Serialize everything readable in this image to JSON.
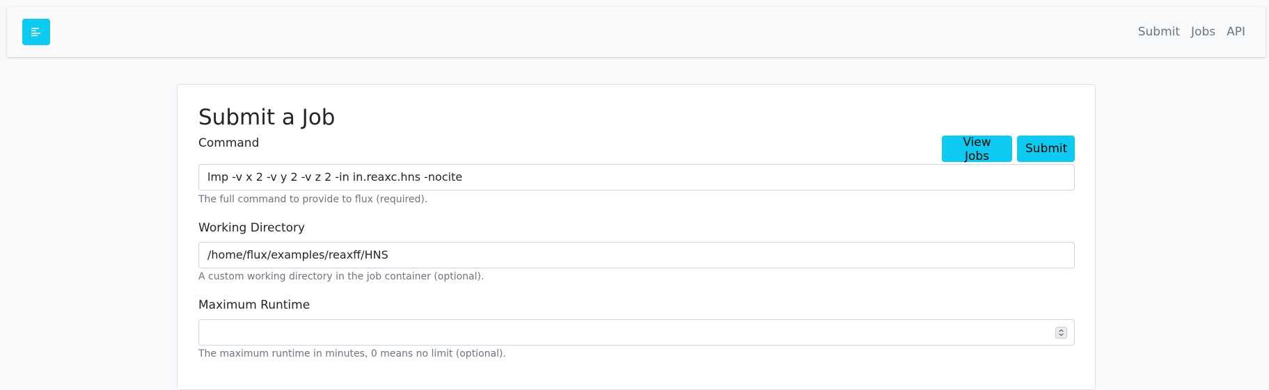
{
  "navbar": {
    "toggle_icon": "menu-lines-icon",
    "accent_color": "#0dcaf0",
    "links": [
      {
        "label": "Submit"
      },
      {
        "label": "Jobs"
      },
      {
        "label": "API"
      }
    ]
  },
  "form": {
    "title": "Submit a Job",
    "view_jobs_label": "View Jobs",
    "submit_label": "Submit",
    "fields": [
      {
        "label": "Command",
        "value": "lmp -v x 2 -v y 2 -v z 2 -in in.reaxc.hns -nocite",
        "help": "The full command to provide to flux (required)."
      },
      {
        "label": "Working Directory",
        "value": "/home/flux/examples/reaxff/HNS",
        "help": "A custom working directory in the job container (optional)."
      },
      {
        "label": "Maximum Runtime",
        "value": "",
        "help": "The maximum runtime in minutes, 0 means no limit (optional).",
        "spinner_icon": "spinner-arrows-icon"
      }
    ]
  }
}
